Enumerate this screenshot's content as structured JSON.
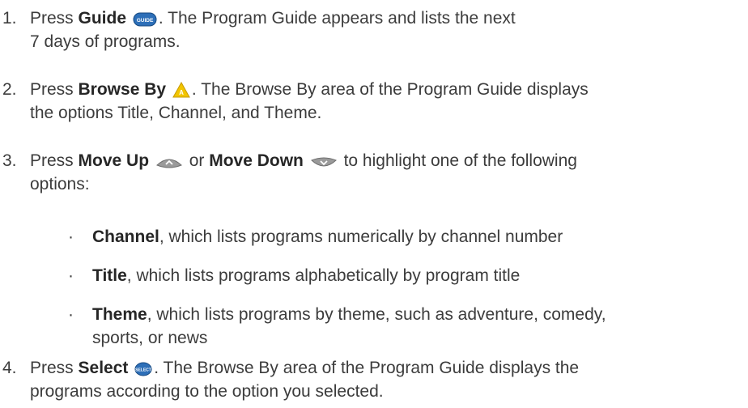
{
  "steps": [
    {
      "num": "1.",
      "pre": "Press ",
      "bold": "Guide",
      "icon_text": "GUIDE",
      "post": ". The Program Guide appears and lists the next",
      "line2": "7 days of programs."
    },
    {
      "num": "2.",
      "pre": "Press ",
      "bold": "Browse By",
      "icon_text": "A",
      "post": ". The Browse By area of the Program Guide displays",
      "line2": "the options Title, Channel, and Theme."
    },
    {
      "num": "3.",
      "pre": "Press ",
      "bold_up": "Move Up",
      "or": " or ",
      "bold_down": "Move Down",
      "post": " to highlight one of the following",
      "line2": "options:"
    },
    {
      "num": "4.",
      "pre": "Press ",
      "bold": "Select",
      "icon_text": "SELECT",
      "post": ". The Browse By area of the Program Guide displays the",
      "line2": "programs according to the option you selected."
    }
  ],
  "bullets": [
    {
      "bullet": "·",
      "bold": "Channel",
      "text": ", which lists programs numerically by channel number",
      "line2": ""
    },
    {
      "bullet": "·",
      "bold": "Title",
      "text": ", which lists programs alphabetically by program title",
      "line2": ""
    },
    {
      "bullet": "·",
      "bold": "Theme",
      "text": ", which lists programs by theme, such as adventure, comedy,",
      "line2": "sports, or news"
    }
  ],
  "icons": {
    "guide": "guide-button-icon",
    "browse": "browse-by-a-triangle-icon",
    "up": "move-up-arrow-icon",
    "down": "move-down-arrow-icon",
    "select": "select-button-icon"
  },
  "colors": {
    "text": "#3c3c3c",
    "bold": "#262626",
    "button_blue": "#2d6fb8",
    "button_gray": "#9a9a9a",
    "triangle": "#f2c500"
  }
}
